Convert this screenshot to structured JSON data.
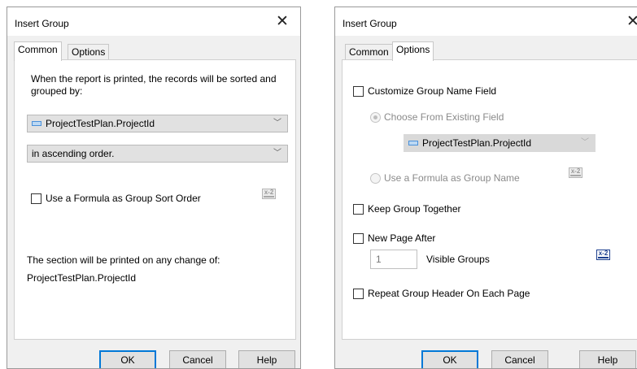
{
  "dialog_common": {
    "title": "Insert Group",
    "close_glyph": "✕",
    "tabs": [
      "Common",
      "Options"
    ],
    "active_tab": "Common",
    "instructions": [
      "When the report is printed, the records will be sorted and",
      "grouped by:"
    ],
    "field_combo": {
      "value": "ProjectTestPlan.ProjectId",
      "icon": "field-icon"
    },
    "order_combo": {
      "value": "in ascending order."
    },
    "formula_sort_checkbox": {
      "label": "Use a Formula as Group Sort Order",
      "checked": false
    },
    "section_note": [
      "The section will be printed on any change of:",
      "ProjectTestPlan.ProjectId"
    ],
    "buttons": {
      "ok": "OK",
      "cancel": "Cancel",
      "help": "Help"
    }
  },
  "dialog_options": {
    "title": "Insert Group",
    "close_glyph": "✕",
    "tabs": [
      "Common",
      "Options"
    ],
    "active_tab": "Options",
    "customize_group_name": {
      "label": "Customize Group Name Field",
      "checked": false
    },
    "choose_existing_radio": {
      "label": "Choose From Existing Field",
      "selected": true,
      "enabled": false
    },
    "existing_field_combo": {
      "value": "ProjectTestPlan.ProjectId",
      "enabled": false
    },
    "formula_name_radio": {
      "label": "Use a Formula as Group Name",
      "selected": false,
      "enabled": false
    },
    "keep_together": {
      "label": "Keep Group Together",
      "checked": false
    },
    "new_page_after": {
      "label": "New Page After",
      "checked": false
    },
    "visible_groups": {
      "value": "1",
      "label": "Visible Groups"
    },
    "repeat_header": {
      "label": "Repeat Group Header On Each Page",
      "checked": false
    },
    "buttons": {
      "ok": "OK",
      "cancel": "Cancel",
      "help": "Help"
    }
  },
  "icons": {
    "formula": "formula-icon",
    "close": "close-icon",
    "dropdown": "chevron-down-icon"
  },
  "colors": {
    "accent": "#0078d7",
    "dialog_bg": "#f0f0f0",
    "combo_bg": "#e1e1e1"
  }
}
